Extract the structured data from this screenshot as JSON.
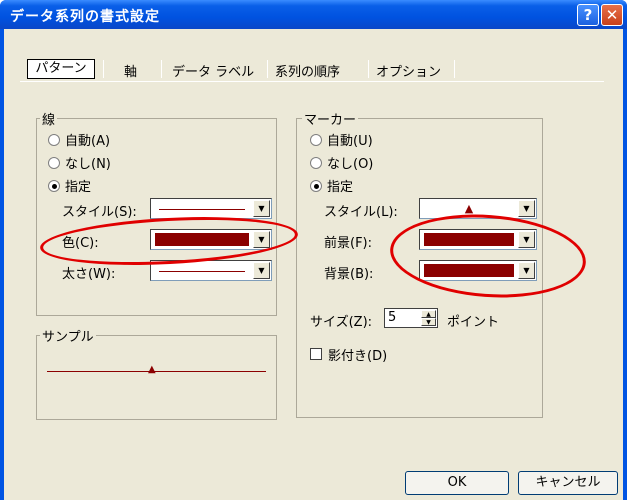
{
  "window": {
    "title": "データ系列の書式設定",
    "help_glyph": "?",
    "close_glyph": "✕"
  },
  "tabs": [
    {
      "label": "パターン",
      "selected": true
    },
    {
      "label": "軸"
    },
    {
      "label": "データ ラベル"
    },
    {
      "label": "系列の順序"
    },
    {
      "label": "オプション"
    }
  ],
  "line_group": {
    "title": "線",
    "options": [
      "自動(A)",
      "なし(N)",
      "指定"
    ],
    "selected": "指定",
    "style_label": "スタイル(S):",
    "color_label": "色(C):",
    "weight_label": "太さ(W):"
  },
  "sample_group": {
    "title": "サンプル"
  },
  "marker_group": {
    "title": "マーカー",
    "options": [
      "自動(U)",
      "なし(O)",
      "指定"
    ],
    "selected": "指定",
    "style_label": "スタイル(L):",
    "style_glyph": "▲",
    "fore_label": "前景(F):",
    "back_label": "背景(B):",
    "size_label": "サイズ(Z):",
    "size_value": "5",
    "size_unit": "ポイント",
    "shadow_label": "影付き(D)",
    "shadow_checked": false
  },
  "buttons": {
    "ok": "OK",
    "cancel": "キャンセル"
  },
  "colors": {
    "series": "#8b0000",
    "annotation": "#e00000",
    "titlebar": "#0054e3",
    "dialog_bg": "#ece9d8"
  },
  "icons": {
    "dropdown": "▼",
    "spin_up": "▲",
    "spin_down": "▼"
  }
}
